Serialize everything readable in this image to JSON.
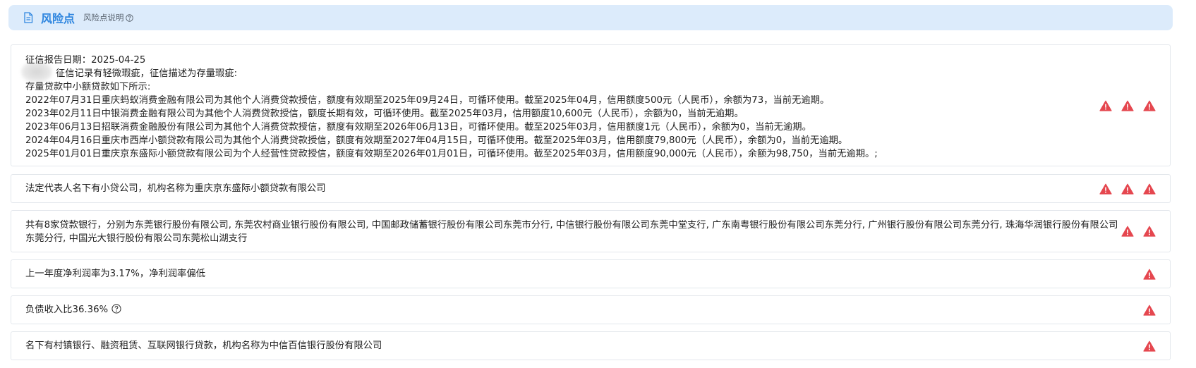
{
  "header": {
    "title": "风险点",
    "subtitle": "风险点说明"
  },
  "items": [
    {
      "lines": [
        "征信报告日期：2025-04-25",
        "征信记录有轻微瑕疵，征信描述为存量瑕疵:",
        "存量贷款中小额贷款如下所示:",
        "2022年07月31日重庆蚂蚁消费金融有限公司为其他个人消费贷款授信，额度有效期至2025年09月24日，可循环使用。截至2025年04月，信用额度500元（人民币），余额为73，当前无逾期。",
        "2023年02月11日中银消费金融有限公司为其他个人消费贷款授信，额度长期有效，可循环使用。截至2025年03月，信用额度10,600元（人民币），余额为0，当前无逾期。",
        "2023年06月13日招联消费金融股份有限公司为其他个人消费贷款授信，额度有效期至2026年06月13日，可循环使用。截至2025年03月，信用额度1元（人民币），余额为0，当前无逾期。",
        "2024年04月16日重庆市西岸小额贷款有限公司为其他个人消费贷款授信，额度有效期至2027年04月15日，可循环使用。截至2025年03月，信用额度79,800元（人民币），余额为0，当前无逾期。",
        "2025年01月01日重庆京东盛际小额贷款有限公司为个人经营性贷款授信，额度有效期至2026年01月01日，可循环使用。截至2025年03月，信用额度90,000元（人民币），余额为98,750，当前无逾期。;"
      ],
      "warn_count": 3
    },
    {
      "text": "法定代表人名下有小贷公司，机构名称为重庆京东盛际小额贷款有限公司",
      "warn_count": 3
    },
    {
      "text": "共有8家贷款银行，分别为东莞银行股份有限公司, 东莞农村商业银行股份有限公司, 中国邮政储蓄银行股份有限公司东莞市分行, 中信银行股份有限公司东莞中堂支行, 广东南粤银行股份有限公司东莞分行, 广州银行股份有限公司东莞分行, 珠海华润银行股份有限公司东莞分行, 中国光大银行股份有限公司东莞松山湖支行",
      "warn_count": 2
    },
    {
      "text": "上一年度净利润率为3.17%，净利润率偏低",
      "warn_count": 1
    },
    {
      "text": "负债收入比36.36%",
      "warn_count": 1,
      "has_help": true
    },
    {
      "text": "名下有村镇银行、融资租赁、互联网银行贷款，机构名称为中信百信银行股份有限公司",
      "warn_count": 1
    }
  ],
  "colors": {
    "accent": "#2f86df",
    "header_bg": "#dcebfb",
    "warning": "#e5474f",
    "border": "#e3e7ec"
  },
  "icons": {
    "header": "document-icon",
    "help": "question-circle-icon",
    "warning": "warning-triangle-icon"
  }
}
